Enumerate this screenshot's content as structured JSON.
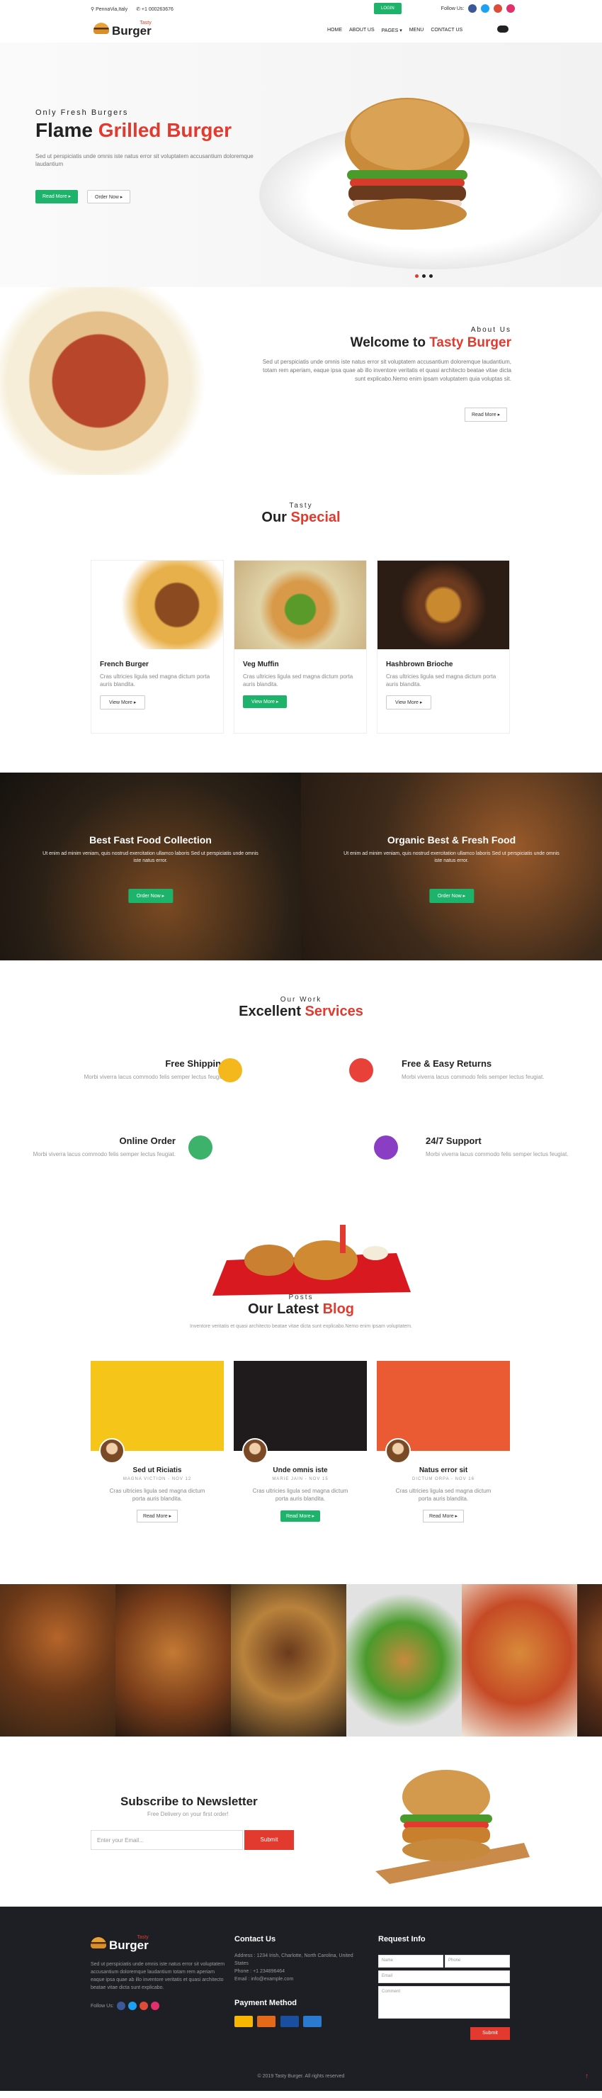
{
  "topbar": {
    "location": "PennaVia,Italy",
    "phone": "+1 000263676",
    "login": "LOGIN",
    "follow": "Follow Us:"
  },
  "nav": {
    "logo_small": "Tasty",
    "logo_big": "Burger",
    "items": [
      "HOME",
      "ABOUT US",
      "PAGES ▾",
      "MENU",
      "CONTACT US"
    ]
  },
  "hero": {
    "subtitle": "Only Fresh Burgers",
    "title_a": "Flame",
    "title_b": "Grilled Burger",
    "text": "Sed ut perspiciatis unde omnis iste natus error sit voluptatem accusantium doloremque laudantium",
    "btn1": "Read More ▸",
    "btn2": "Order Now ▸"
  },
  "welcome": {
    "subtitle": "About Us",
    "title_a": "Welcome to",
    "title_b": "Tasty Burger",
    "text": "Sed ut perspiciatis unde omnis iste natus error sit voluptatem accusantium doloremque laudantium, totam rem aperiam, eaque ipsa quae ab illo inventore veritatis et quasi architecto beatae vitae dicta sunt explicabo.Nemo enim ipsam voluptatem quia voluptas sit.",
    "btn": "Read More ▸"
  },
  "special": {
    "subtitle": "Tasty",
    "title_a": "Our",
    "title_b": "Special",
    "cards": [
      {
        "title": "French Burger",
        "text": "Cras ultricies ligula sed magna dictum porta auris blandita.",
        "btn": "View More ▸"
      },
      {
        "title": "Veg Muffin",
        "text": "Cras ultricies ligula sed magna dictum porta auris blandita.",
        "btn": "View More ▸"
      },
      {
        "title": "Hashbrown Brioche",
        "text": "Cras ultricies ligula sed magna dictum porta auris blandita.",
        "btn": "View More ▸"
      }
    ]
  },
  "banners": [
    {
      "title": "Best Fast Food Collection",
      "text": "Ut enim ad minim veniam, quis nostrud exercitation ullamco laboris Sed ut perspiciatis unde omnis iste natus error.",
      "btn": "Order Now ▸"
    },
    {
      "title": "Organic Best & Fresh Food",
      "text": "Ut enim ad minim veniam, quis nostrud exercitation ullamco laboris Sed ut perspiciatis unde omnis iste natus error.",
      "btn": "Order Now ▸"
    }
  ],
  "services": {
    "subtitle": "Our Work",
    "title_a": "Excellent",
    "title_b": "Services",
    "items": [
      {
        "title": "Free Shipping",
        "text": "Morbi viverra lacus commodo felis semper lectus feugiat."
      },
      {
        "title": "Free & Easy Returns",
        "text": "Morbi viverra lacus commodo felis semper lectus feugiat."
      },
      {
        "title": "Online Order",
        "text": "Morbi viverra lacus commodo felis semper lectus feugiat."
      },
      {
        "title": "24/7 Support",
        "text": "Morbi viverra lacus commodo felis semper lectus feugiat."
      }
    ]
  },
  "blog": {
    "subtitle": "Posts",
    "title_a": "Our Latest",
    "title_b": "Blog",
    "intro": "Inventore veritatis et quasi architecto beatae vitae dicta sunt explicabo.Nemo enim ipsam voluptatem.",
    "cards": [
      {
        "title": "Sed ut Riciatis",
        "meta": "MAGNA VICTION - NOV 12",
        "text": "Cras ultricies ligula sed magna dictum porta auris blandita.",
        "btn": "Read More ▸"
      },
      {
        "title": "Unde omnis iste",
        "meta": "MARIE JAIN - NOV 15",
        "text": "Cras ultricies ligula sed magna dictum porta auris blandita.",
        "btn": "Read More ▸"
      },
      {
        "title": "Natus error sit",
        "meta": "DICTUM ORPA - NOV 16",
        "text": "Cras ultricies ligula sed magna dictum porta auris blandita.",
        "btn": "Read More ▸"
      }
    ]
  },
  "newsletter": {
    "title": "Subscribe to Newsletter",
    "subtitle": "Free Delivery on your first order!",
    "placeholder": "Enter your Email...",
    "btn": "Submit"
  },
  "footer": {
    "logo_small": "Tasty",
    "logo_big": "Burger",
    "about": "Sed ut perspiciatis unde omnis iste natus error sit voluptatem accusantium doloremque laudantium totam rem aperiam eaque ipsa quae ab illo inventore veritatis et quasi architecto beatae vitae dicta sunt explicabo.",
    "follow": "Follow Us:",
    "contact_title": "Contact Us",
    "address": "Address : 1234 Irish, Charlotte, North Carolina, United States",
    "phone": "Phone : +1 234896464",
    "email": "Email : info@example.com",
    "payment_title": "Payment Method",
    "request_title": "Request Info",
    "name": "Name",
    "phone_ph": "Phone",
    "email_ph": "Email",
    "comment": "Comment",
    "submit": "Submit",
    "copyright": "© 2019 Tasty Burger. All rights reserved"
  }
}
